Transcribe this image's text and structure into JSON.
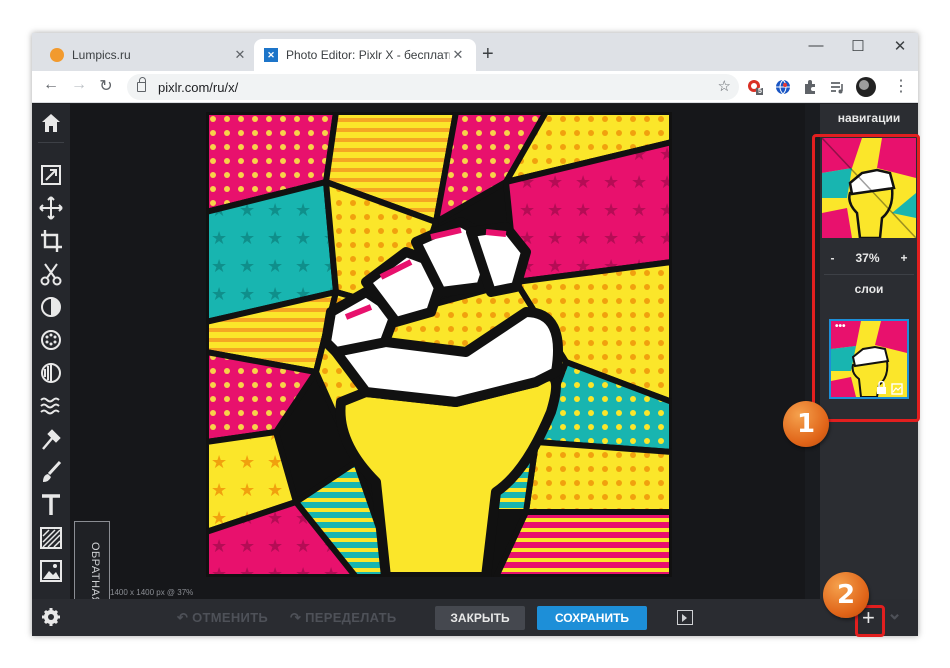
{
  "browser": {
    "tabs": [
      {
        "title": "Lumpics.ru",
        "close": "✕"
      },
      {
        "title": "Photo Editor: Pixlr X - бесплатный",
        "close": "✕"
      }
    ],
    "new_tab": "+",
    "window_controls": {
      "minimize": "—",
      "maximize": "☐",
      "close": "✕"
    },
    "address": "pixlr.com/ru/x/",
    "extension_badge": "5"
  },
  "editor": {
    "image_info": "1400 x 1400 px @ 37%",
    "feedback_label": "ОБРАТНАЯ СВЯЗЬ",
    "navigation_heading": "навигации",
    "zoom_minus": "-",
    "zoom_value": "37%",
    "zoom_plus": "+",
    "layers_heading": "слои",
    "layer_menu": "•••",
    "undo_label": "ОТМЕНИТЬ",
    "redo_label": "ПЕРЕДЕЛАТЬ",
    "close_label": "ЗАКРЫТЬ",
    "save_label": "СОХРАНИТЬ",
    "add_label": "+",
    "chevrons": {
      "up": "^",
      "down": "⌄"
    }
  },
  "annotations": {
    "badge1": "1",
    "badge2": "2"
  },
  "colors": {
    "accent_save": "#1d8fd8",
    "highlight_red": "#e21f1f",
    "badge_orange": "#e06418"
  }
}
